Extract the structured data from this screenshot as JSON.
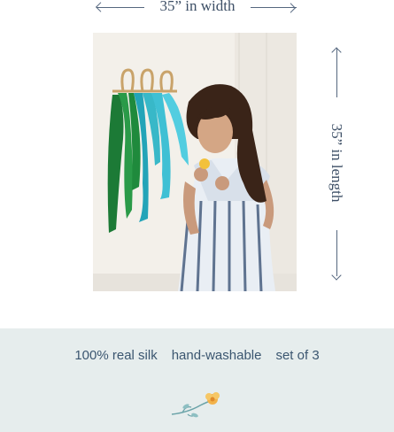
{
  "dimensions": {
    "width_label": "35” in width",
    "length_label": "35” in length"
  },
  "features": [
    "100% real silk",
    "hand-washable",
    "set of 3"
  ],
  "colors": {
    "band": "#e6eded",
    "text": "#3b5670",
    "green_silk": "#1f8a3c",
    "teal_silk": "#33b8c6",
    "blue_silk": "#4cc9e0"
  },
  "icons": [
    "arrow-left-icon",
    "arrow-right-icon",
    "arrow-up-icon",
    "arrow-down-icon",
    "flower-icon"
  ]
}
